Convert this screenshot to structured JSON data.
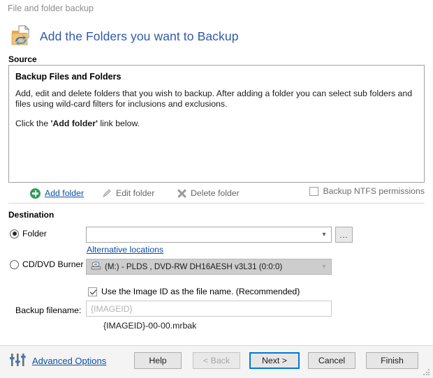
{
  "window": {
    "title": "File and folder backup"
  },
  "header": {
    "icon": "folder-backup-icon",
    "title": "Add the Folders you want to Backup"
  },
  "source": {
    "group_label": "Source",
    "panel_heading": "Backup Files and Folders",
    "paragraph1": "Add, edit and delete folders that you wish to backup. After adding a folder you can select sub folders and files using wild-card filters for inclusions and exclusions.",
    "paragraph2_prefix": "Click the ",
    "paragraph2_bold": "'Add folder'",
    "paragraph2_suffix": " link below.",
    "toolbar": {
      "add_label": "Add folder",
      "edit_label": "Edit folder",
      "delete_label": "Delete folder",
      "ntfs_label": "Backup NTFS permissions",
      "ntfs_checked": false
    }
  },
  "destination": {
    "group_label": "Destination",
    "folder_radio_label": "Folder",
    "folder_radio_selected": true,
    "folder_combo_value": "",
    "browse_button_label": "...",
    "alternative_locations_label": "Alternative locations",
    "cd_radio_label": "CD/DVD Burner",
    "cd_radio_selected": false,
    "cd_combo_value": "(M:)  - PLDS    , DVD-RW DH16AESH  v3L31 (0:0:0)",
    "use_image_id_label": "Use the Image ID as the file name.  (Recommended)",
    "use_image_id_checked": true,
    "backup_filename_label": "Backup filename:",
    "backup_filename_value": "{IMAGEID}",
    "backup_filename_preview": "{IMAGEID}-00-00.mrbak"
  },
  "footer": {
    "advanced_options_label": "Advanced Options",
    "buttons": [
      {
        "label": "Help",
        "state": "normal"
      },
      {
        "label": "< Back",
        "state": "disabled"
      },
      {
        "label": "Next >",
        "state": "focused"
      },
      {
        "label": "Cancel",
        "state": "normal"
      },
      {
        "label": "Finish",
        "state": "normal"
      }
    ]
  },
  "colors": {
    "accent_link": "#0b4fa8",
    "heading_blue": "#2f5aa8",
    "focus_border": "#0078d7",
    "add_icon_green": "#2e9e57",
    "footer_bg": "#f4f4f4"
  }
}
